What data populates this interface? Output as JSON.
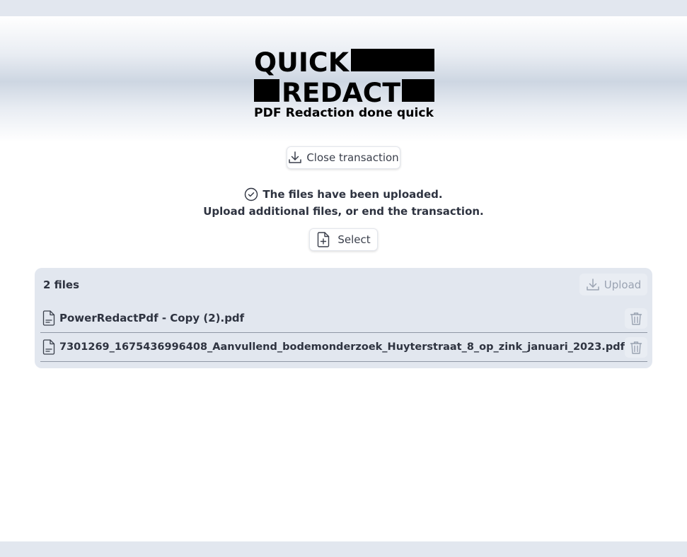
{
  "logo": {
    "line1": "QUICK",
    "line2": "REDACT",
    "tagline": "PDF Redaction done quick"
  },
  "actions": {
    "close_label": "Close transaction",
    "select_label": "Select"
  },
  "status": {
    "uploaded_message": "The files have been uploaded.",
    "instruction": "Upload additional files, or end the transaction."
  },
  "files_panel": {
    "count_label": "2 files",
    "upload_label": "Upload",
    "files": [
      {
        "name": "PowerRedactPdf - Copy (2).pdf"
      },
      {
        "name": "7301269_1675436996408_Aanvullend_bodemonderzoek_Huyterstraat_8_op_zink_januari_2023.pdf"
      }
    ]
  },
  "icons": {
    "close": "download-icon",
    "status": "check-circle-icon",
    "select": "file-plus-icon",
    "upload": "download-icon",
    "file": "file-text-icon",
    "delete": "trash-icon"
  },
  "colors": {
    "panel_bg": "#e2e7ef",
    "text": "#2e3340",
    "disabled_text": "#9aa3b2"
  }
}
